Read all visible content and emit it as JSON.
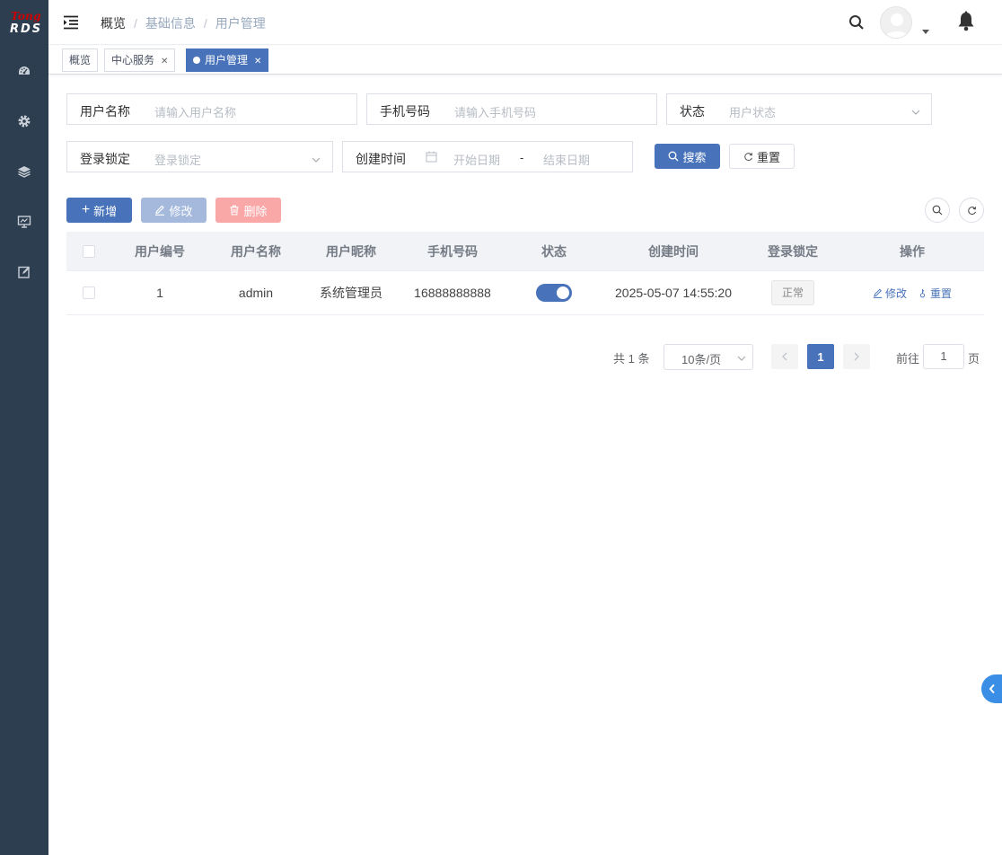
{
  "logo": {
    "top": "Tong",
    "bottom": "RDS"
  },
  "sidebar": {
    "icons": [
      "dashboard-icon",
      "gear-icon",
      "layers-icon",
      "monitor-icon",
      "edit-icon"
    ]
  },
  "breadcrumb": [
    "概览",
    "基础信息",
    "用户管理"
  ],
  "tags": [
    {
      "label": "概览",
      "closable": false,
      "active": false
    },
    {
      "label": "中心服务",
      "closable": true,
      "active": false
    },
    {
      "label": "用户管理",
      "closable": true,
      "active": true
    }
  ],
  "search": {
    "username": {
      "label": "用户名称",
      "placeholder": "请输入用户名称"
    },
    "phone": {
      "label": "手机号码",
      "placeholder": "请输入手机号码"
    },
    "status": {
      "label": "状态",
      "placeholder": "用户状态"
    },
    "lock": {
      "label": "登录锁定",
      "placeholder": "登录锁定"
    },
    "created": {
      "label": "创建时间",
      "start": "开始日期",
      "separator": "-",
      "end": "结束日期"
    },
    "search_btn": "搜索",
    "reset_btn": "重置"
  },
  "toolbar": {
    "add": "新增",
    "edit": "修改",
    "delete": "删除"
  },
  "table": {
    "columns": [
      "用户编号",
      "用户名称",
      "用户昵称",
      "手机号码",
      "状态",
      "创建时间",
      "登录锁定",
      "操作"
    ],
    "rows": [
      {
        "id": "1",
        "username": "admin",
        "nickname": "系统管理员",
        "phone": "16888888888",
        "status_on": true,
        "created": "2025-05-07 14:55:20",
        "lock": "正常",
        "op_edit": "修改",
        "op_reset": "重置"
      }
    ]
  },
  "pagination": {
    "total": "共 1 条",
    "page_size": "10条/页",
    "current": "1",
    "goto_label": "前往",
    "goto_value": "1",
    "goto_unit": "页"
  },
  "colors": {
    "primary": "#4872b9",
    "sidebar": "#2c3e50"
  }
}
